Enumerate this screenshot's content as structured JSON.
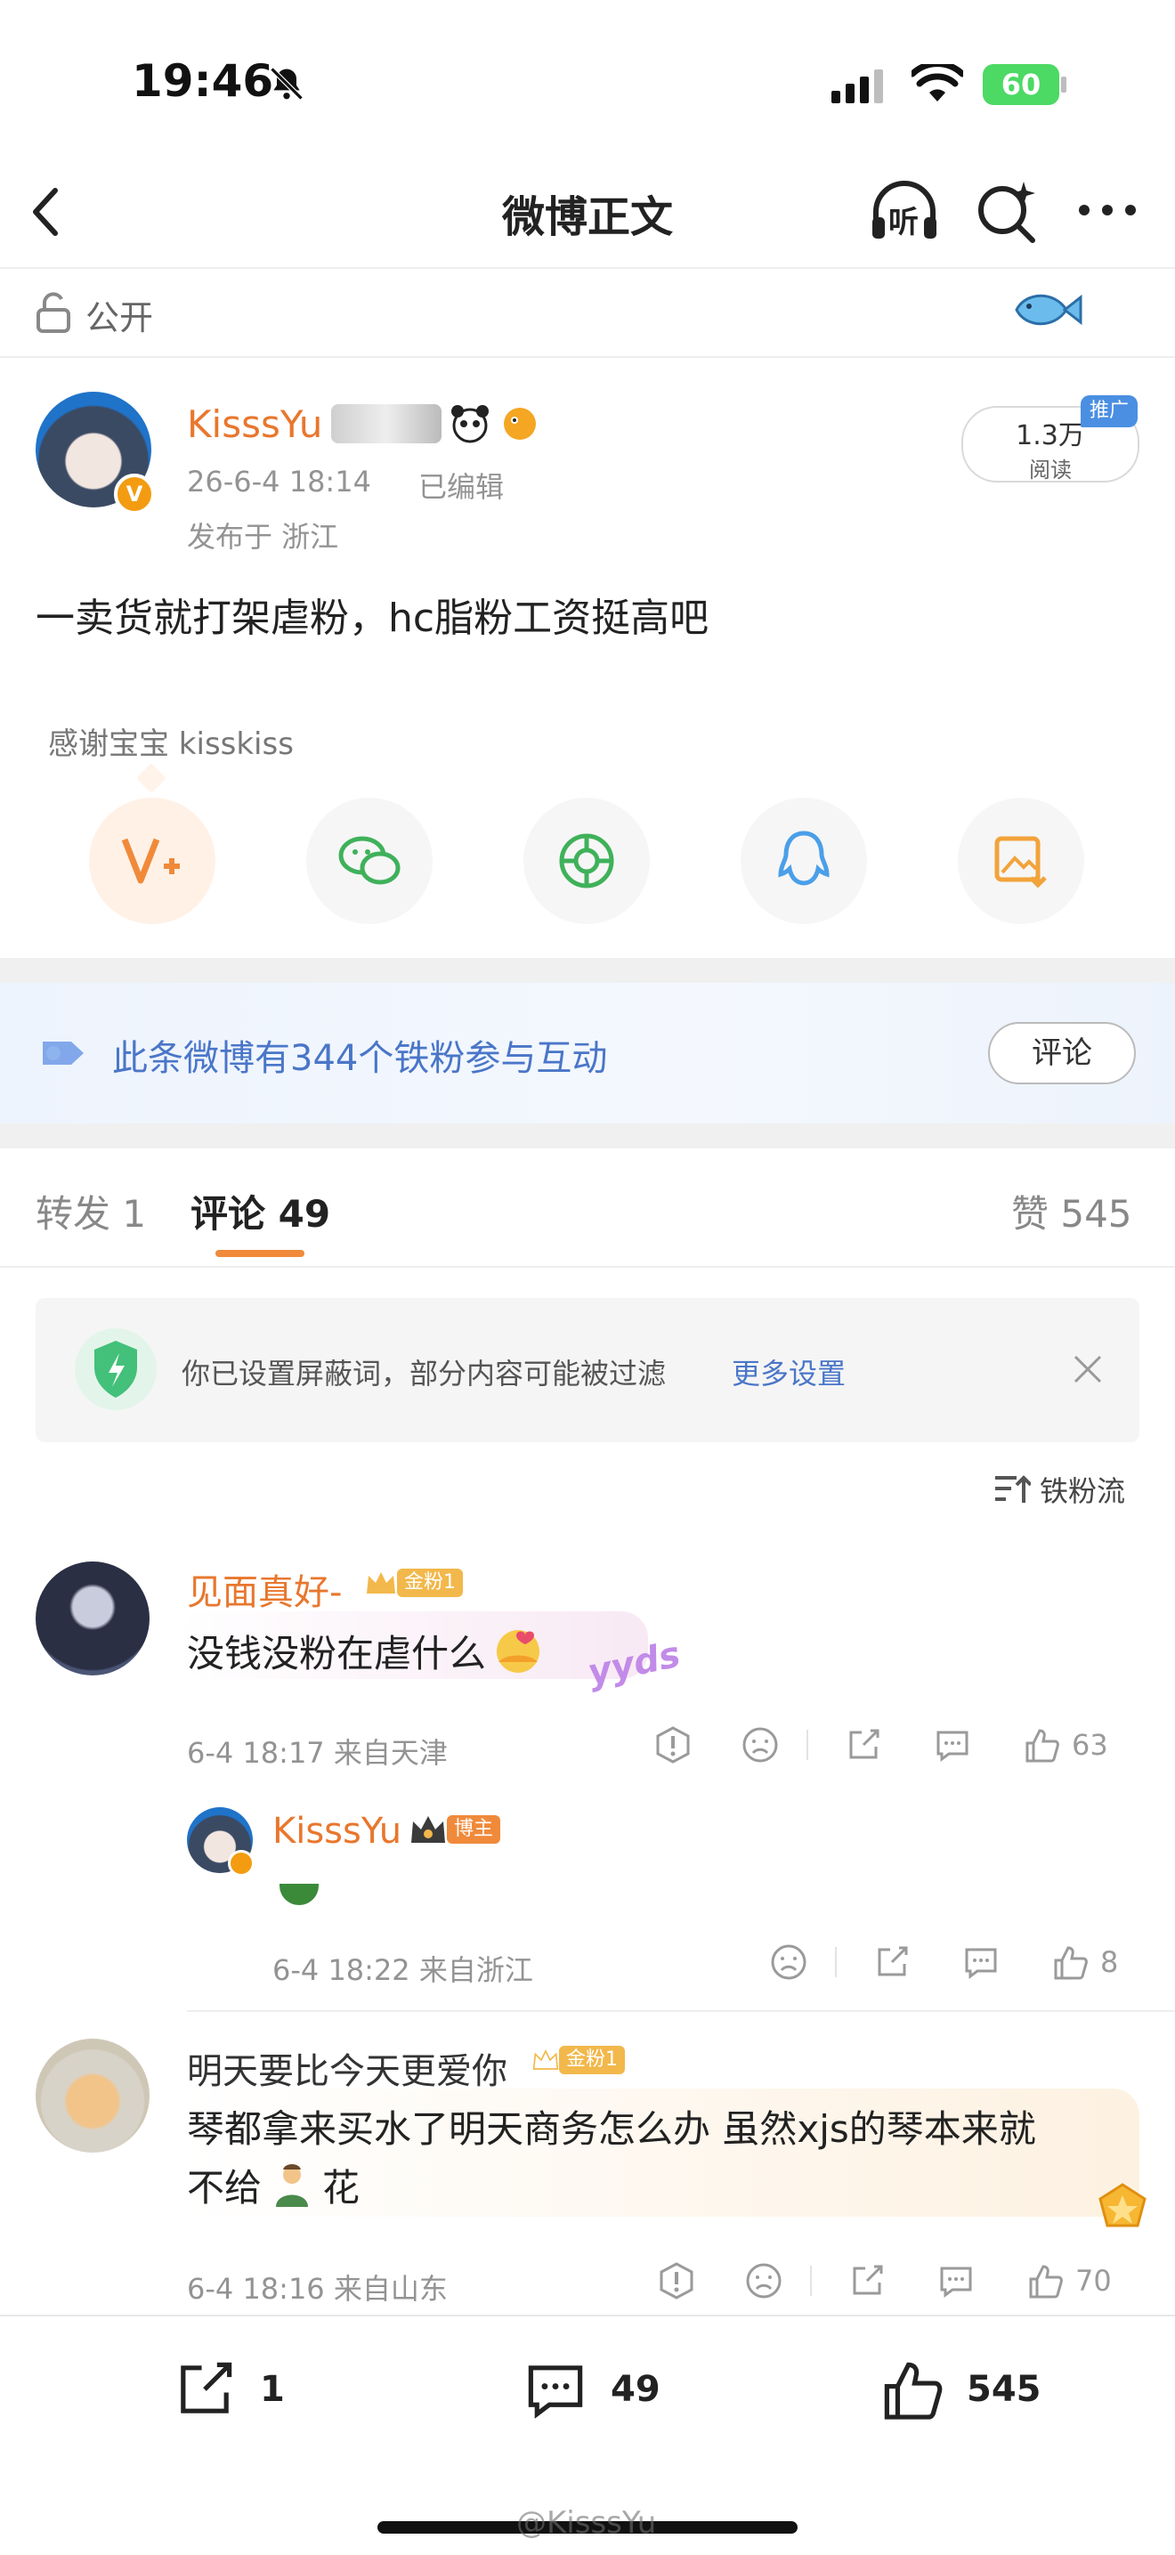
{
  "status_bar": {
    "time": "19:46",
    "battery": "60"
  },
  "nav": {
    "title": "微博正文",
    "listen_label": "听"
  },
  "visibility": {
    "label": "公开"
  },
  "post": {
    "author": "KisssYu",
    "date": "26-6-4 18:14",
    "edited": "已编辑",
    "location": "发布于 浙江",
    "views_value": "1.3万",
    "views_label": "阅读",
    "promo_badge": "推广",
    "text": "一卖货就打架虐粉，hc脂粉工资挺高吧",
    "thanks": "感谢宝宝 kisskiss"
  },
  "fans_banner": {
    "text": "此条微博有344个铁粉参与互动",
    "button": "评论"
  },
  "tabs": {
    "repost": "转发 1",
    "comment": "评论 49",
    "like": "赞 545"
  },
  "filter_notice": {
    "text": "你已设置屏蔽词，部分内容可能被过滤",
    "link": "更多设置"
  },
  "sort": {
    "label": "铁粉流"
  },
  "comments": [
    {
      "user": "见面真好-",
      "badge": "金粉1",
      "text": "没钱没粉在虐什么",
      "sticker": "yyds",
      "meta": "6-4 18:17 来自天津",
      "likes": "63",
      "reply": {
        "user": "KisssYu",
        "badge": "博主",
        "meta": "6-4 18:22 来自浙江",
        "likes": "8"
      }
    },
    {
      "user": "明天要比今天更爱你",
      "badge": "金粉1",
      "text_line1": "琴都拿来买水了明天商务怎么办 虽然xjs的琴本来就",
      "text_line2": "不给",
      "text_line2_end": "花",
      "meta": "6-4 18:16 来自山东",
      "likes": "70"
    }
  ],
  "bottom_bar": {
    "repost": "1",
    "comment": "49",
    "like": "545"
  },
  "watermark": "@KisssYu",
  "colors": {
    "accent": "#e8772e",
    "link": "#4a76c8",
    "badge_gold": "#f2b84b",
    "badge_owner": "#f08a3a"
  }
}
